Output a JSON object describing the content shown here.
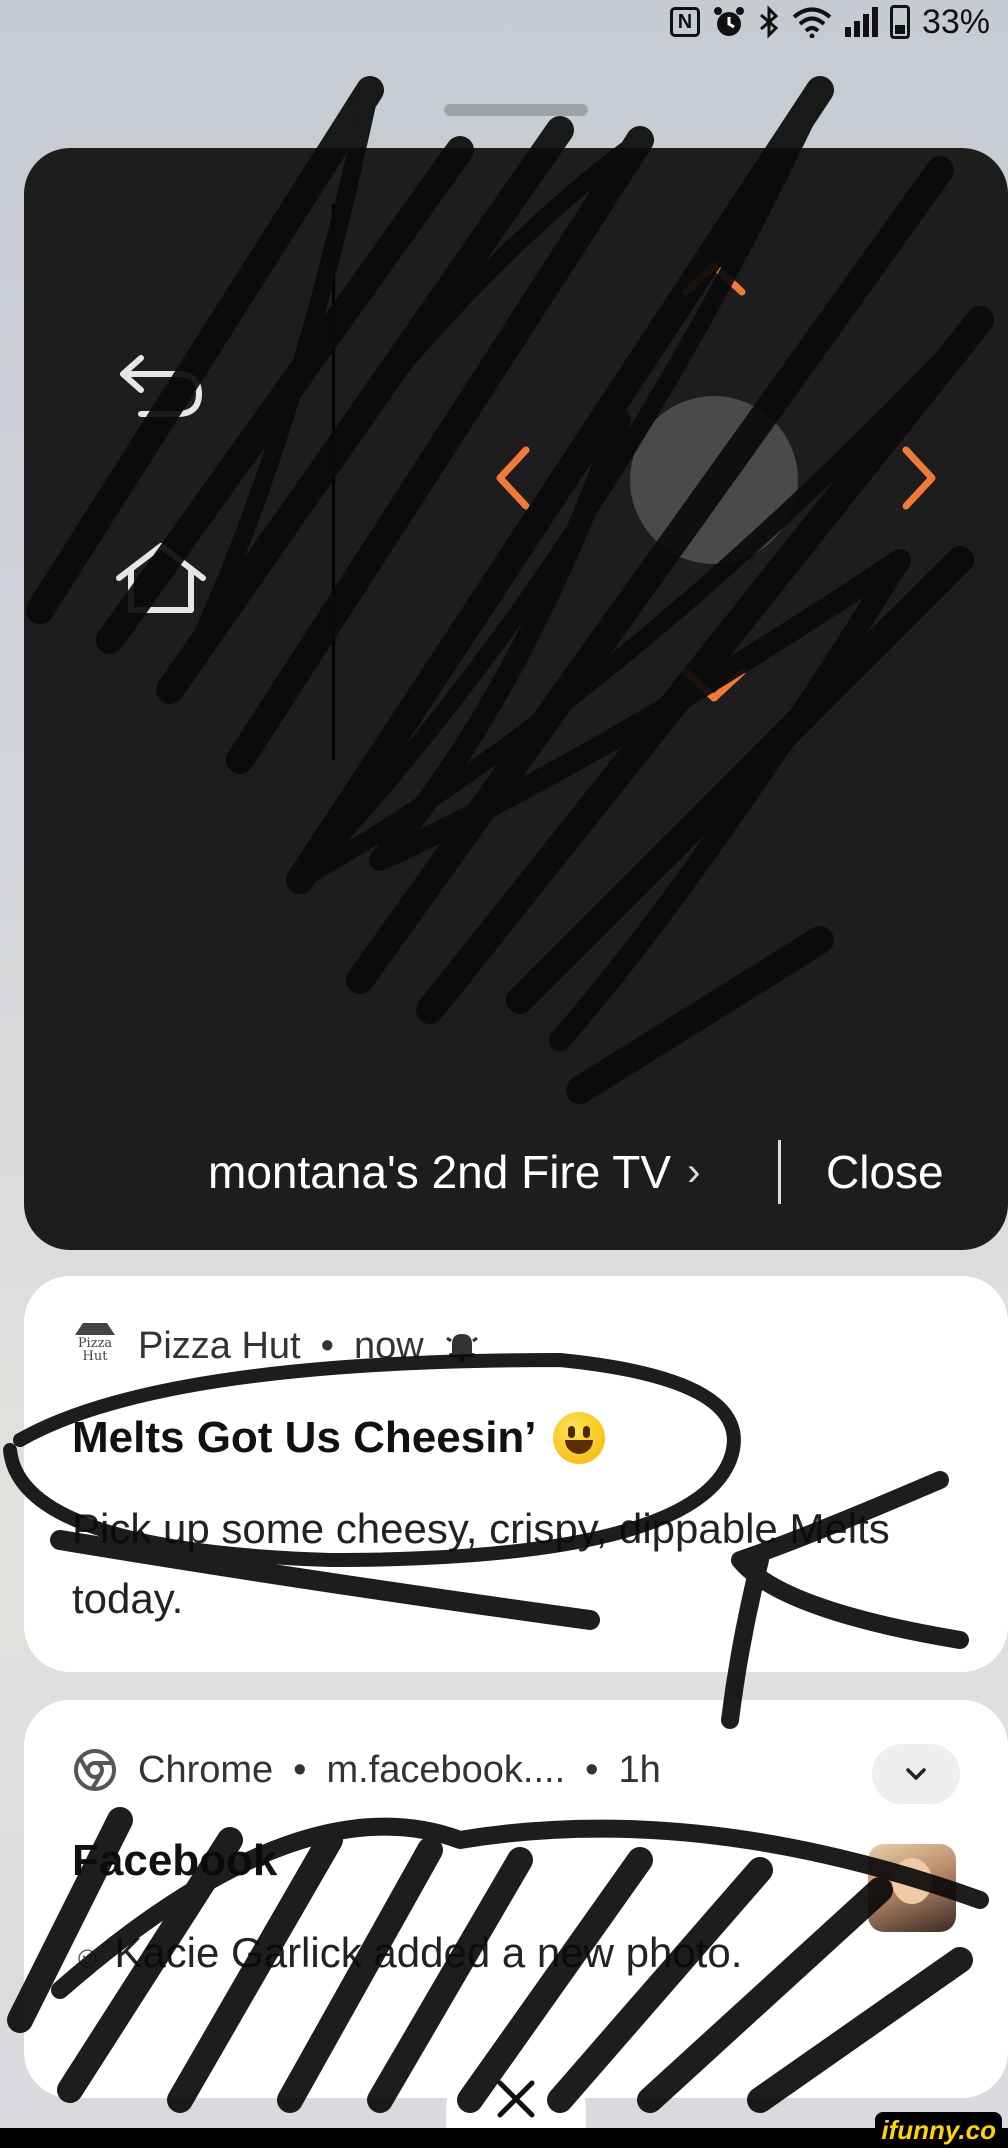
{
  "status_bar": {
    "nfc_icon": "nfc-icon",
    "alarm_icon": "alarm-icon",
    "bluetooth_icon": "bluetooth-icon",
    "wifi_icon": "wifi-icon",
    "signal_icon": "signal-icon",
    "battery_percent": "33%"
  },
  "remote": {
    "device_name": "montana's 2nd Fire TV",
    "device_chevron": "›",
    "close_label": "Close",
    "accent_color": "#f07a3a",
    "icons": {
      "back": "back-icon",
      "home": "home-icon",
      "up": "arrow-up-icon",
      "down": "arrow-down-icon",
      "left": "arrow-left-icon",
      "right": "arrow-right-icon"
    }
  },
  "notifications": [
    {
      "app": "Pizza Hut",
      "time": "now",
      "separator": "•",
      "title": "Melts Got Us Cheesin’",
      "body": "Pick up some cheesy, crispy, dippable Melts today."
    },
    {
      "app": "Chrome",
      "source": "m.facebook....",
      "time": "1h",
      "separator": "•",
      "title": "Facebook",
      "body": "Kacie Garlick added a new photo."
    }
  ],
  "watermark": "ifunny.co"
}
